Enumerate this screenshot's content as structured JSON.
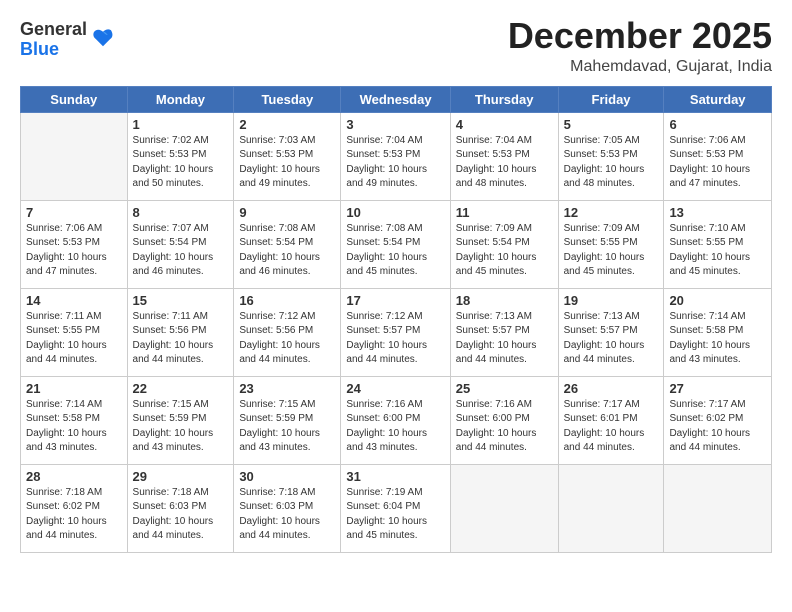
{
  "header": {
    "logo_general": "General",
    "logo_blue": "Blue",
    "month_title": "December 2025",
    "location": "Mahemdavad, Gujarat, India"
  },
  "weekdays": [
    "Sunday",
    "Monday",
    "Tuesday",
    "Wednesday",
    "Thursday",
    "Friday",
    "Saturday"
  ],
  "weeks": [
    [
      {
        "day": "",
        "info": ""
      },
      {
        "day": "1",
        "info": "Sunrise: 7:02 AM\nSunset: 5:53 PM\nDaylight: 10 hours\nand 50 minutes."
      },
      {
        "day": "2",
        "info": "Sunrise: 7:03 AM\nSunset: 5:53 PM\nDaylight: 10 hours\nand 49 minutes."
      },
      {
        "day": "3",
        "info": "Sunrise: 7:04 AM\nSunset: 5:53 PM\nDaylight: 10 hours\nand 49 minutes."
      },
      {
        "day": "4",
        "info": "Sunrise: 7:04 AM\nSunset: 5:53 PM\nDaylight: 10 hours\nand 48 minutes."
      },
      {
        "day": "5",
        "info": "Sunrise: 7:05 AM\nSunset: 5:53 PM\nDaylight: 10 hours\nand 48 minutes."
      },
      {
        "day": "6",
        "info": "Sunrise: 7:06 AM\nSunset: 5:53 PM\nDaylight: 10 hours\nand 47 minutes."
      }
    ],
    [
      {
        "day": "7",
        "info": "Sunrise: 7:06 AM\nSunset: 5:53 PM\nDaylight: 10 hours\nand 47 minutes."
      },
      {
        "day": "8",
        "info": "Sunrise: 7:07 AM\nSunset: 5:54 PM\nDaylight: 10 hours\nand 46 minutes."
      },
      {
        "day": "9",
        "info": "Sunrise: 7:08 AM\nSunset: 5:54 PM\nDaylight: 10 hours\nand 46 minutes."
      },
      {
        "day": "10",
        "info": "Sunrise: 7:08 AM\nSunset: 5:54 PM\nDaylight: 10 hours\nand 45 minutes."
      },
      {
        "day": "11",
        "info": "Sunrise: 7:09 AM\nSunset: 5:54 PM\nDaylight: 10 hours\nand 45 minutes."
      },
      {
        "day": "12",
        "info": "Sunrise: 7:09 AM\nSunset: 5:55 PM\nDaylight: 10 hours\nand 45 minutes."
      },
      {
        "day": "13",
        "info": "Sunrise: 7:10 AM\nSunset: 5:55 PM\nDaylight: 10 hours\nand 45 minutes."
      }
    ],
    [
      {
        "day": "14",
        "info": "Sunrise: 7:11 AM\nSunset: 5:55 PM\nDaylight: 10 hours\nand 44 minutes."
      },
      {
        "day": "15",
        "info": "Sunrise: 7:11 AM\nSunset: 5:56 PM\nDaylight: 10 hours\nand 44 minutes."
      },
      {
        "day": "16",
        "info": "Sunrise: 7:12 AM\nSunset: 5:56 PM\nDaylight: 10 hours\nand 44 minutes."
      },
      {
        "day": "17",
        "info": "Sunrise: 7:12 AM\nSunset: 5:57 PM\nDaylight: 10 hours\nand 44 minutes."
      },
      {
        "day": "18",
        "info": "Sunrise: 7:13 AM\nSunset: 5:57 PM\nDaylight: 10 hours\nand 44 minutes."
      },
      {
        "day": "19",
        "info": "Sunrise: 7:13 AM\nSunset: 5:57 PM\nDaylight: 10 hours\nand 44 minutes."
      },
      {
        "day": "20",
        "info": "Sunrise: 7:14 AM\nSunset: 5:58 PM\nDaylight: 10 hours\nand 43 minutes."
      }
    ],
    [
      {
        "day": "21",
        "info": "Sunrise: 7:14 AM\nSunset: 5:58 PM\nDaylight: 10 hours\nand 43 minutes."
      },
      {
        "day": "22",
        "info": "Sunrise: 7:15 AM\nSunset: 5:59 PM\nDaylight: 10 hours\nand 43 minutes."
      },
      {
        "day": "23",
        "info": "Sunrise: 7:15 AM\nSunset: 5:59 PM\nDaylight: 10 hours\nand 43 minutes."
      },
      {
        "day": "24",
        "info": "Sunrise: 7:16 AM\nSunset: 6:00 PM\nDaylight: 10 hours\nand 43 minutes."
      },
      {
        "day": "25",
        "info": "Sunrise: 7:16 AM\nSunset: 6:00 PM\nDaylight: 10 hours\nand 44 minutes."
      },
      {
        "day": "26",
        "info": "Sunrise: 7:17 AM\nSunset: 6:01 PM\nDaylight: 10 hours\nand 44 minutes."
      },
      {
        "day": "27",
        "info": "Sunrise: 7:17 AM\nSunset: 6:02 PM\nDaylight: 10 hours\nand 44 minutes."
      }
    ],
    [
      {
        "day": "28",
        "info": "Sunrise: 7:18 AM\nSunset: 6:02 PM\nDaylight: 10 hours\nand 44 minutes."
      },
      {
        "day": "29",
        "info": "Sunrise: 7:18 AM\nSunset: 6:03 PM\nDaylight: 10 hours\nand 44 minutes."
      },
      {
        "day": "30",
        "info": "Sunrise: 7:18 AM\nSunset: 6:03 PM\nDaylight: 10 hours\nand 44 minutes."
      },
      {
        "day": "31",
        "info": "Sunrise: 7:19 AM\nSunset: 6:04 PM\nDaylight: 10 hours\nand 45 minutes."
      },
      {
        "day": "",
        "info": ""
      },
      {
        "day": "",
        "info": ""
      },
      {
        "day": "",
        "info": ""
      }
    ]
  ]
}
